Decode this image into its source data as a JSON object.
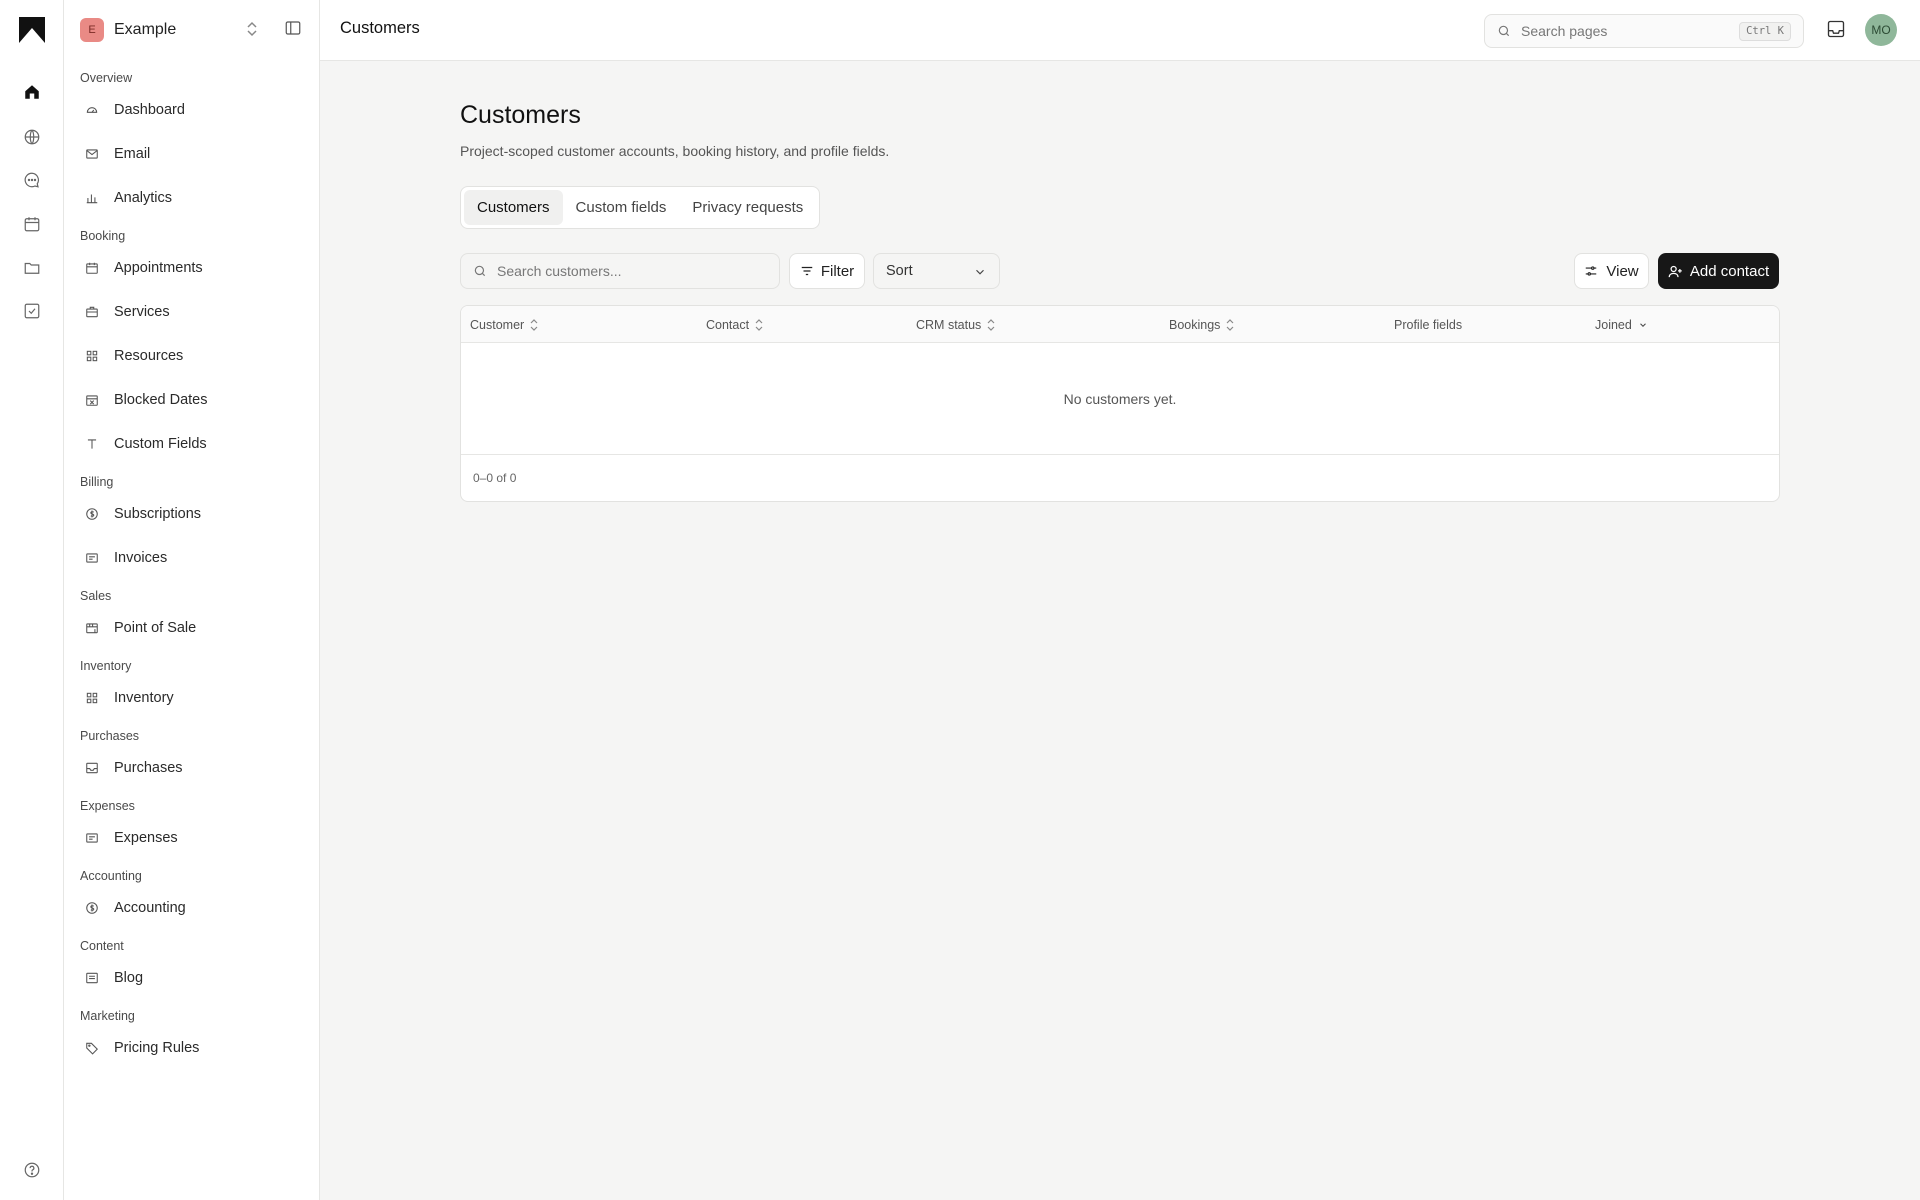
{
  "rail": {
    "items": [
      "home-icon",
      "globe-icon",
      "chat-icon",
      "calendar-icon",
      "folder-icon",
      "checklist-icon"
    ],
    "help": "help-icon"
  },
  "workspace": {
    "badge": "E",
    "name": "Example"
  },
  "sidebar": {
    "sections": [
      {
        "title": "Overview",
        "items": [
          {
            "label": "Dashboard",
            "icon": "dashboard-icon"
          },
          {
            "label": "Email",
            "icon": "mail-icon"
          },
          {
            "label": "Analytics",
            "icon": "chart-icon"
          }
        ]
      },
      {
        "title": "Booking",
        "items": [
          {
            "label": "Appointments",
            "icon": "calendar-icon"
          },
          {
            "label": "Services",
            "icon": "briefcase-icon"
          },
          {
            "label": "Resources",
            "icon": "grid-icon"
          },
          {
            "label": "Blocked Dates",
            "icon": "calendar-x-icon"
          },
          {
            "label": "Custom Fields",
            "icon": "text-icon"
          }
        ]
      },
      {
        "title": "Billing",
        "items": [
          {
            "label": "Subscriptions",
            "icon": "dollar-circle-icon"
          },
          {
            "label": "Invoices",
            "icon": "receipt-icon"
          }
        ]
      },
      {
        "title": "Sales",
        "items": [
          {
            "label": "Point of Sale",
            "icon": "store-icon"
          }
        ]
      },
      {
        "title": "Inventory",
        "items": [
          {
            "label": "Inventory",
            "icon": "grid-icon"
          }
        ]
      },
      {
        "title": "Purchases",
        "items": [
          {
            "label": "Purchases",
            "icon": "inbox-icon"
          }
        ]
      },
      {
        "title": "Expenses",
        "items": [
          {
            "label": "Expenses",
            "icon": "receipt-icon"
          }
        ]
      },
      {
        "title": "Accounting",
        "items": [
          {
            "label": "Accounting",
            "icon": "dollar-circle-icon"
          }
        ]
      },
      {
        "title": "Content",
        "items": [
          {
            "label": "Blog",
            "icon": "article-icon"
          }
        ]
      },
      {
        "title": "Marketing",
        "items": [
          {
            "label": "Pricing Rules",
            "icon": "tag-icon"
          }
        ]
      }
    ]
  },
  "topbar": {
    "title": "Customers",
    "search_placeholder": "Search pages",
    "search_shortcut": "Ctrl K",
    "avatar": "MO"
  },
  "page": {
    "title": "Customers",
    "subtitle": "Project-scoped customer accounts, booking history, and profile fields.",
    "tabs": [
      "Customers",
      "Custom fields",
      "Privacy requests"
    ],
    "active_tab": "Customers"
  },
  "toolbar": {
    "search_placeholder": "Search customers...",
    "filter_label": "Filter",
    "sort_label": "Sort",
    "view_label": "View",
    "add_label": "Add contact"
  },
  "table": {
    "columns": [
      "Customer",
      "Contact",
      "CRM status",
      "Bookings",
      "Profile fields",
      "Joined"
    ],
    "empty_text": "No customers yet.",
    "pagination": "0–0 of 0"
  }
}
